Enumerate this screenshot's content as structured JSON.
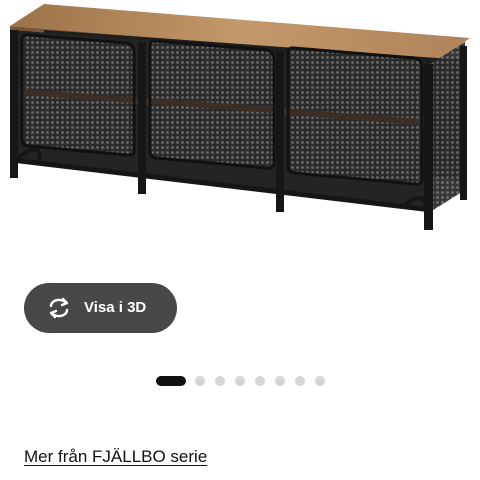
{
  "product": {
    "image_alt": "FJÄLLBO TV-bänk",
    "colors": {
      "top": "#b98c5c",
      "frame": "#1a1a1a",
      "shelf": "#3a2f26"
    }
  },
  "view_3d": {
    "label": "Visa i 3D",
    "icon": "rotate-3d-icon"
  },
  "carousel": {
    "total": 8,
    "active_index": 0
  },
  "series_link": {
    "label": "Mer från FJÄLLBO serie"
  }
}
